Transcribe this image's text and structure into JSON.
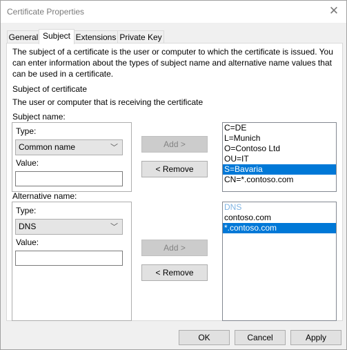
{
  "window": {
    "title": "Certificate Properties",
    "close_icon": "close-x-icon"
  },
  "tabs": [
    {
      "label": "General",
      "active": false
    },
    {
      "label": "Subject",
      "active": true
    },
    {
      "label": "Extensions",
      "active": false
    },
    {
      "label": "Private Key",
      "active": false
    }
  ],
  "subject_tab": {
    "description_line1": "The subject of a certificate is the user or computer to which the certificate is issued. You",
    "description_line2": "can enter information about the types of subject name and alternative name values that",
    "description_line3": "can be used in a certificate.",
    "heading": "Subject of certificate",
    "subheading": "The user or computer that is receiving the certificate",
    "subject_name": {
      "group_label": "Subject name:",
      "type_label": "Type:",
      "type_value": "Common name",
      "value_label": "Value:",
      "value": "",
      "add_label": "Add >",
      "add_enabled": false,
      "remove_label": "< Remove",
      "list": [
        {
          "text": "C=DE",
          "selected": false
        },
        {
          "text": "L=Munich",
          "selected": false
        },
        {
          "text": "O=Contoso Ltd",
          "selected": false
        },
        {
          "text": "OU=IT",
          "selected": false
        },
        {
          "text": "S=Bavaria",
          "selected": true
        },
        {
          "text": "CN=*.contoso.com",
          "selected": false
        }
      ]
    },
    "alternative_name": {
      "group_label": "Alternative name:",
      "type_label": "Type:",
      "type_value": "DNS",
      "value_label": "Value:",
      "value": "",
      "add_label": "Add >",
      "add_enabled": false,
      "remove_label": "< Remove",
      "list_header": "DNS",
      "list": [
        {
          "text": "contoso.com",
          "selected": false
        },
        {
          "text": "*.contoso.com",
          "selected": true
        }
      ]
    }
  },
  "footer": {
    "ok_label": "OK",
    "cancel_label": "Cancel",
    "apply_label": "Apply"
  },
  "colors": {
    "selection": "#0078d7",
    "list_header": "#7fb4e3"
  }
}
